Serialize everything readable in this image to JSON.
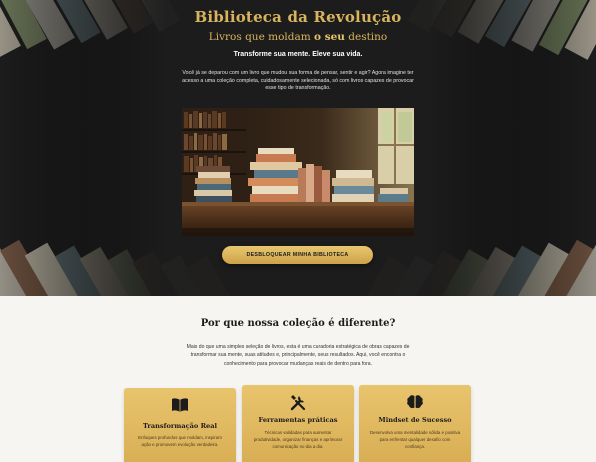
{
  "hero": {
    "title": "Biblioteca da Revolução",
    "subtitle_pre": "Livros que moldam ",
    "subtitle_bold": "o seu",
    "subtitle_post": " destino",
    "tagline": "Transforme sua mente. Eleve sua vida.",
    "intro_text": "Você já se deparou com um livro que mudou sua forma de pensar, sentir e agir? Agora imagine ter acesso a uma coleção completa, cuidadosamente selecionada, só com livros capazes de provocar esse tipo de transformação.",
    "cta_label": "DESBLOQUEAR MINHA BIBLIOTECA",
    "colors": {
      "accent": "#d8b45e",
      "background": "#1c1c1c"
    }
  },
  "features": {
    "title": "Por que nossa coleção é diferente?",
    "text": "Mais do que uma simples seleção de livros, esta é uma curadoria estratégica de obras capazes de transformar sua mente, suas atitudes e, principalmente, seus resultados. Aqui, você encontra o conhecimento para provocar mudanças reais de dentro para fora.",
    "cards": [
      {
        "icon": "open-book-icon",
        "title": "Transformação Real",
        "text": "Enfoques profundos que moldam, inspiram ação e promovem evolução verdadeira."
      },
      {
        "icon": "tools-icon",
        "title": "Ferramentas práticas",
        "text": "Técnicas validadas para aumentar produtividade, organizar finanças e aprimorar comunicação no dia a dia."
      },
      {
        "icon": "brain-icon",
        "title": "Mindset de Sucesso",
        "text": "Desenvolva uma mentalidade sólida e positiva para enfrentar qualquer desafio com confiança."
      }
    ]
  }
}
